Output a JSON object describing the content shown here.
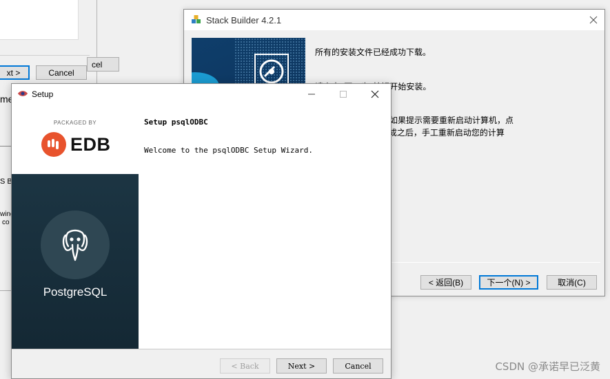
{
  "back_window_1": {
    "next_label": "xt >",
    "cancel_label": "Cancel"
  },
  "back_window_2": {
    "button_label": "cel"
  },
  "behind_fragments": {
    "frag_1": "me",
    "frag_2": "S Bu",
    "frag_3": "wing",
    "frag_4": "co"
  },
  "stack_builder": {
    "title": "Stack Builder 4.2.1",
    "lines": [
      "所有的安装文件已经成功下载。",
      "请点击“下一步”按钮开始安装。",
      "有的安装直到完成，如果提示需要重新启动计算机，点",
      "动”(在所有的安装完成之后，手工重新启动您的计算"
    ],
    "back_label": "< 返回(B)",
    "next_label": "下一个(N) >",
    "cancel_label": "取消(C)"
  },
  "setup": {
    "title": "Setup",
    "packaged_by": "PACKAGED BY",
    "brand": "EDB",
    "product": "PostgreSQL",
    "heading": "Setup psqlODBC",
    "welcome": "Welcome to the psqlODBC Setup Wizard.",
    "back_label": "< Back",
    "next_label": "Next >",
    "cancel_label": "Cancel"
  },
  "watermark": "CSDN @承诺早已泛黄",
  "colors": {
    "edb_orange": "#e8532d",
    "postgres_panel": "#1c3543",
    "focus_blue": "#0078d7"
  }
}
